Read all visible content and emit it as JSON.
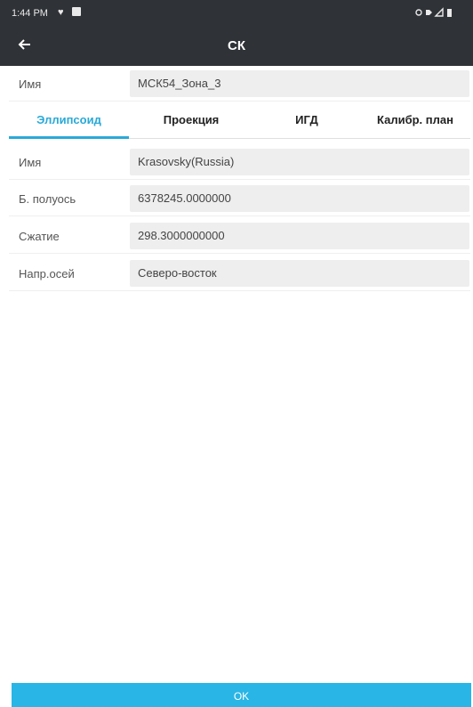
{
  "status_bar": {
    "time": "1:44 PM",
    "right_icons": "♥ ◢ ▮"
  },
  "app_bar": {
    "title": "СК",
    "back_icon": "arrow-left"
  },
  "name_row": {
    "label": "Имя",
    "value": "МСК54_Зона_3"
  },
  "tabs": [
    {
      "label": "Эллипсоид",
      "active": true
    },
    {
      "label": "Проекция",
      "active": false
    },
    {
      "label": "ИГД",
      "active": false
    },
    {
      "label": "Калибр. план",
      "active": false
    }
  ],
  "ellipsoid": {
    "fields": [
      {
        "label": "Имя",
        "value": "Krasovsky(Russia)"
      },
      {
        "label": "Б. полуось",
        "value": "6378245.0000000"
      },
      {
        "label": "Сжатие",
        "value": "298.3000000000"
      },
      {
        "label": "Напр.осей",
        "value": "Северо-восток"
      }
    ]
  },
  "footer": {
    "ok_label": "OK"
  },
  "colors": {
    "bar": "#2f3236",
    "accent": "#29a9d8",
    "ok_button": "#29b5e5"
  }
}
